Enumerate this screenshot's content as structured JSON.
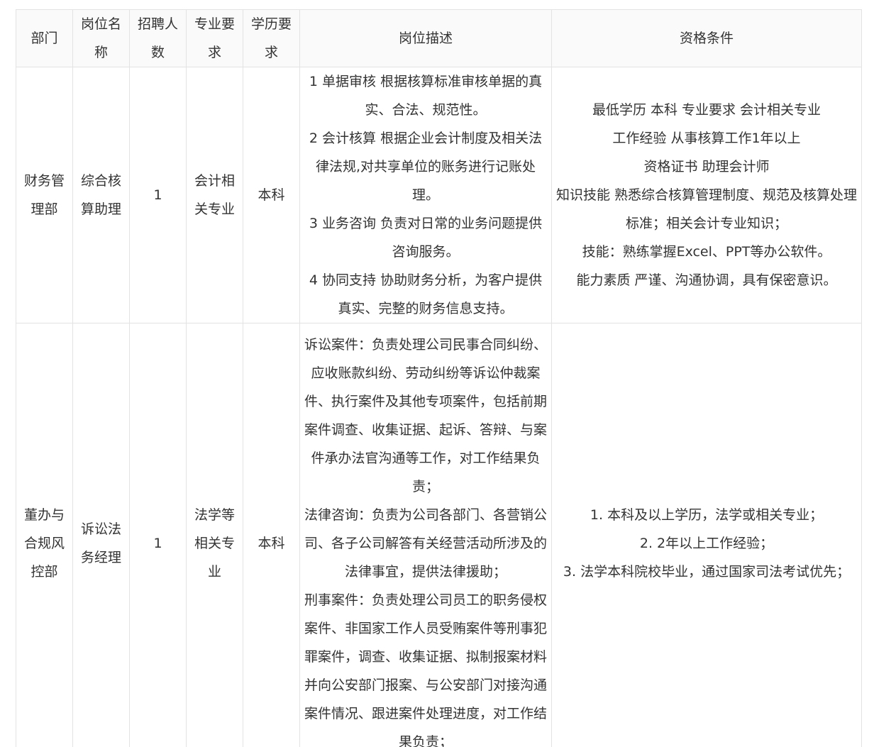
{
  "table": {
    "headers": {
      "department": "部门",
      "position": "岗位名称",
      "count": "招聘人数",
      "major": "专业要求",
      "education": "学历要求",
      "description": "岗位描述",
      "qualification": "资格条件"
    },
    "rows": [
      {
        "department": "财务管理部",
        "position": "综合核算助理",
        "count": "1",
        "major": "会计相关专业",
        "education": "本科",
        "description": [
          "1 单据审核 根据核算标准审核单据的真实、合法、规范性。",
          "2 会计核算 根据企业会计制度及相关法律法规,对共享单位的账务进行记账处理。",
          "3 业务咨询 负责对日常的业务问题提供咨询服务。",
          "4 协同支持 协助财务分析，为客户提供真实、完整的财务信息支持。"
        ],
        "qualification": [
          "最低学历    本科 专业要求 会计相关专业",
          "工作经验    从事核算工作1年以上",
          "资格证书    助理会计师",
          "知识技能    熟悉综合核算管理制度、规范及核算处理标准；相关会计专业知识；",
          "技能：熟练掌握Excel、PPT等办公软件。",
          "能力素质    严谨、沟通协调，具有保密意识。"
        ]
      },
      {
        "department": "董办与合规风控部",
        "position": "诉讼法务经理",
        "count": "1",
        "major": "法学等相关专业",
        "education": "本科",
        "description": [
          "诉讼案件：负责处理公司民事合同纠纷、应收账款纠纷、劳动纠纷等诉讼仲裁案件、执行案件及其他专项案件，包括前期案件调查、收集证据、起诉、答辩、与案件承办法官沟通等工作，对工作结果负责；",
          "法律咨询：负责为公司各部门、各营销公司、各子公司解答有关经营活动所涉及的法律事宜，提供法律援助；",
          "刑事案件：负责处理公司员工的职务侵权案件、非国家工作人员受贿案件等刑事犯罪案件，调查、收集证据、拟制报案材料并向公安部门报案、与公安部门对接沟通案件情况、跟进案件处理进度，对工作结果负责；"
        ],
        "qualification": [
          "1. 本科及以上学历，法学或相关专业；",
          "2. 2年以上工作经验；",
          "3. 法学本科院校毕业，通过国家司法考试优先；"
        ]
      }
    ]
  }
}
